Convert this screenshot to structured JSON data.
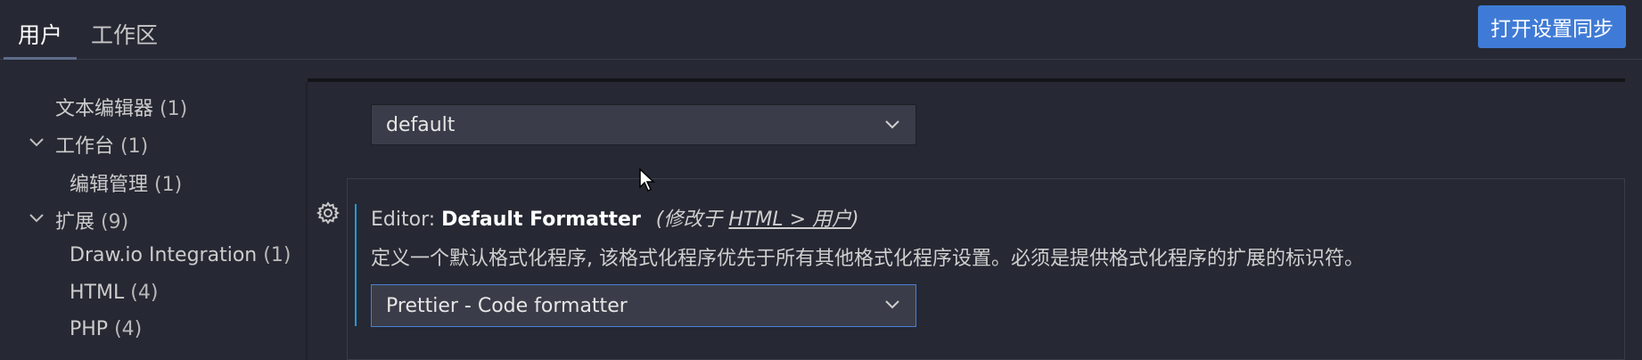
{
  "tabs": [
    {
      "label": "用户",
      "active": true
    },
    {
      "label": "工作区",
      "active": false
    }
  ],
  "sync_button": "打开设置同步",
  "sidebar": {
    "items": [
      {
        "label": "文本编辑器",
        "count": "(1)"
      },
      {
        "label": "工作台",
        "count": "(1)",
        "expanded": true
      },
      {
        "label": "编辑管理",
        "count": "(1)"
      },
      {
        "label": "扩展",
        "count": "(9)",
        "expanded": true
      },
      {
        "label": "Draw.io Integration",
        "count": "(1)"
      },
      {
        "label": "HTML",
        "count": "(4)"
      },
      {
        "label": "PHP",
        "count": "(4)"
      }
    ]
  },
  "main": {
    "prev_select_value": "default",
    "setting": {
      "category": "Editor: ",
      "name": "Default Formatter",
      "modified_prefix": "(修改于 ",
      "modified_link": "HTML > 用户",
      "modified_suffix": ")",
      "description": "定义一个默认格式化程序, 该格式化程序优先于所有其他格式化程序设置。必须是提供格式化程序的扩展的标识符。",
      "select_value": "Prettier - Code formatter"
    }
  },
  "colors": {
    "background": "#262833",
    "accent_button": "#3f7bd6",
    "focus_border": "#4a7fd2",
    "modified_indicator": "#1f9ad6"
  },
  "icons": {
    "gear": "gear-icon",
    "chevron_down": "chevron-down-icon",
    "tree_expanded": "chevron-expanded-icon"
  }
}
